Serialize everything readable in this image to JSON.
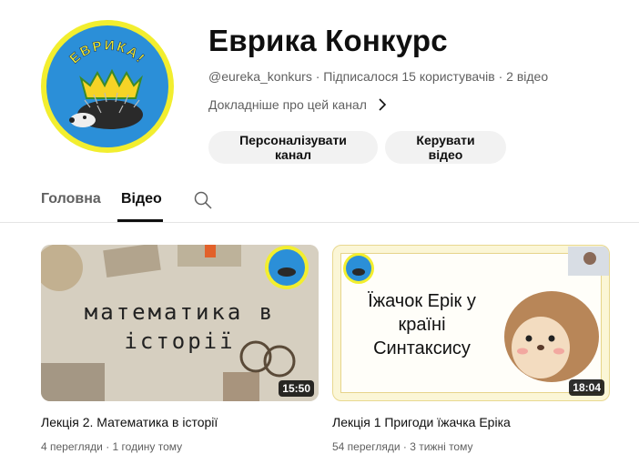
{
  "channel": {
    "title": "Еврика Конкурс",
    "handle": "@eureka_konkurs",
    "subscribers": "Підписалося 15 користувачів",
    "video_count": "2 відео",
    "separator": " · ",
    "about_label": "Докладніше про цей канал",
    "avatar_text": "ЕВРИКА!",
    "colors": {
      "avatar_ring": "#f2ee2f",
      "avatar_bg": "#2b8fd8"
    }
  },
  "actions": {
    "customize_label": "Персоналізувати канал",
    "manage_label": "Керувати відео"
  },
  "tabs": [
    {
      "label": "Головна",
      "active": false
    },
    {
      "label": "Відео",
      "active": true
    }
  ],
  "videos": [
    {
      "title": "Лекція 2. Математика в історії",
      "views": "4 перегляди",
      "age": "1 годину тому",
      "duration": "15:50",
      "thumb_lines": [
        "математика в",
        "історії"
      ]
    },
    {
      "title": "Лекція 1 Пригоди їжачка Еріка",
      "views": "54 перегляди",
      "age": "3 тижні тому",
      "duration": "18:04",
      "thumb_lines": [
        "Їжачок Ерік у",
        "країні",
        "Синтаксису"
      ]
    }
  ]
}
